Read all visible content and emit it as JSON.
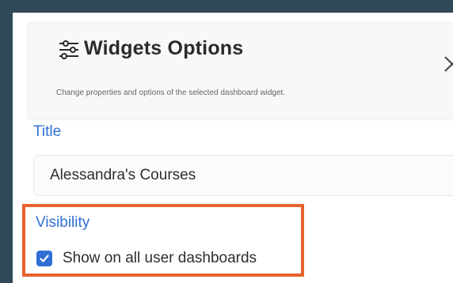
{
  "dialog": {
    "title": "Widgets Options",
    "subtitle": "Change properties and options of the selected dashboard widget.",
    "title_icon": "sliders-icon",
    "close_icon": "close-icon"
  },
  "form": {
    "title_label": "Title",
    "title_value": "Alessandra's Courses",
    "visibility_label": "Visibility",
    "show_all_label": "Show on all user dashboards",
    "show_all_checked": true
  },
  "colors": {
    "accent": "#2f6fd3",
    "highlight": "#e8622e",
    "frame": "#2f4957"
  }
}
